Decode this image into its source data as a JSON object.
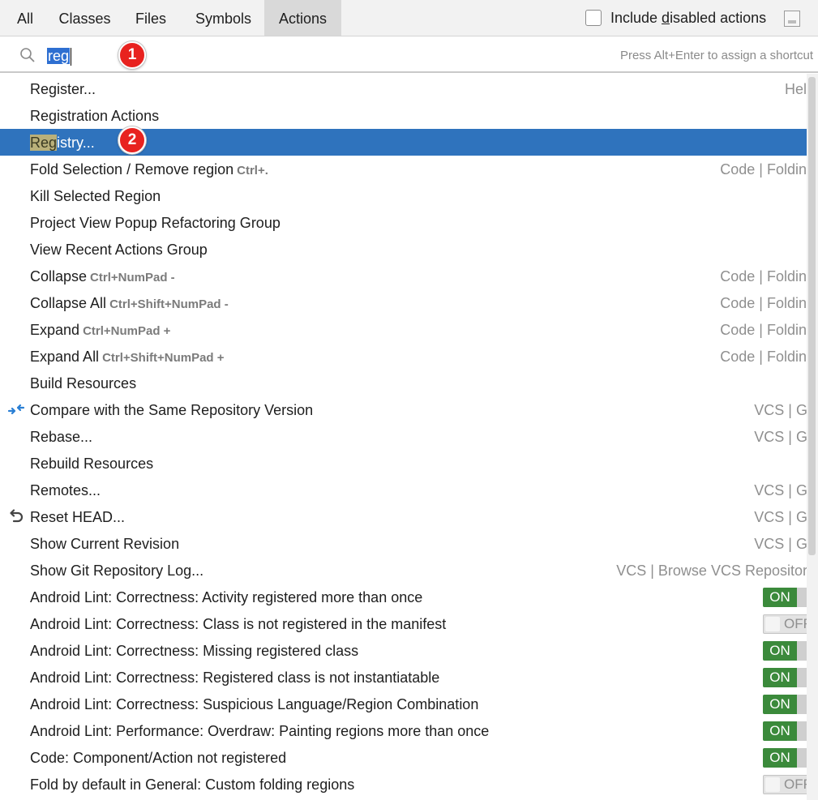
{
  "tabs": [
    {
      "label": "All",
      "active": false
    },
    {
      "label": "Classes",
      "active": false
    },
    {
      "label": "Files",
      "active": false
    },
    {
      "label": "Symbols",
      "active": false
    },
    {
      "label": "Actions",
      "active": true
    }
  ],
  "include_disabled": {
    "before": "Include ",
    "mnemonic": "d",
    "after": "isabled actions",
    "checked": false
  },
  "search": {
    "value": "reg",
    "hint": "Press Alt+Enter to assign a shortcut"
  },
  "badges": {
    "first": "1",
    "second": "2"
  },
  "results": [
    {
      "name": "Register...",
      "group": "Help"
    },
    {
      "name": "Registration Actions"
    },
    {
      "highlight": "Reg",
      "rest": "istry...",
      "selected": true
    },
    {
      "name": "Fold Selection / Remove region",
      "shortcut": "Ctrl+.",
      "group": "Code | Folding"
    },
    {
      "name": "Kill Selected Region"
    },
    {
      "name": "Project View Popup Refactoring Group"
    },
    {
      "name": "View Recent Actions Group"
    },
    {
      "name": "Collapse",
      "shortcut": "Ctrl+NumPad -",
      "group": "Code | Folding"
    },
    {
      "name": "Collapse All",
      "shortcut": "Ctrl+Shift+NumPad -",
      "group": "Code | Folding"
    },
    {
      "name": "Expand",
      "shortcut": "Ctrl+NumPad +",
      "group": "Code | Folding"
    },
    {
      "name": "Expand All",
      "shortcut": "Ctrl+Shift+NumPad +",
      "group": "Code | Folding"
    },
    {
      "name": "Build Resources"
    },
    {
      "name": "Compare with the Same Repository Version",
      "group": "VCS | Git",
      "icon": "compare-arrows-icon"
    },
    {
      "name": "Rebase...",
      "group": "VCS | Git"
    },
    {
      "name": "Rebuild Resources"
    },
    {
      "name": "Remotes...",
      "group": "VCS | Git"
    },
    {
      "name": "Reset HEAD...",
      "group": "VCS | Git",
      "icon": "undo-arrow-icon"
    },
    {
      "name": "Show Current Revision",
      "group": "VCS | Git"
    },
    {
      "name": "Show Git Repository Log...",
      "group": "VCS | Browse VCS Repository"
    },
    {
      "name": "Android Lint: Correctness: Activity registered more than once",
      "toggle": "ON"
    },
    {
      "name": "Android Lint: Correctness: Class is not registered in the manifest",
      "toggle": "OFF"
    },
    {
      "name": "Android Lint: Correctness: Missing registered class",
      "toggle": "ON"
    },
    {
      "name": "Android Lint: Correctness: Registered class is not instantiatable",
      "toggle": "ON"
    },
    {
      "name": "Android Lint: Correctness: Suspicious Language/Region Combination",
      "toggle": "ON"
    },
    {
      "name": "Android Lint: Performance: Overdraw: Painting regions more than once",
      "toggle": "ON"
    },
    {
      "name": "Code: Component/Action not registered",
      "toggle": "ON"
    },
    {
      "name": "Fold by default in General: Custom folding regions",
      "toggle": "OFF"
    }
  ],
  "colors": {
    "selection": "#2f73bd",
    "toggle_on": "#3b8a3b",
    "badge": "#e8221f",
    "search_selection": "#2e6fd1"
  }
}
